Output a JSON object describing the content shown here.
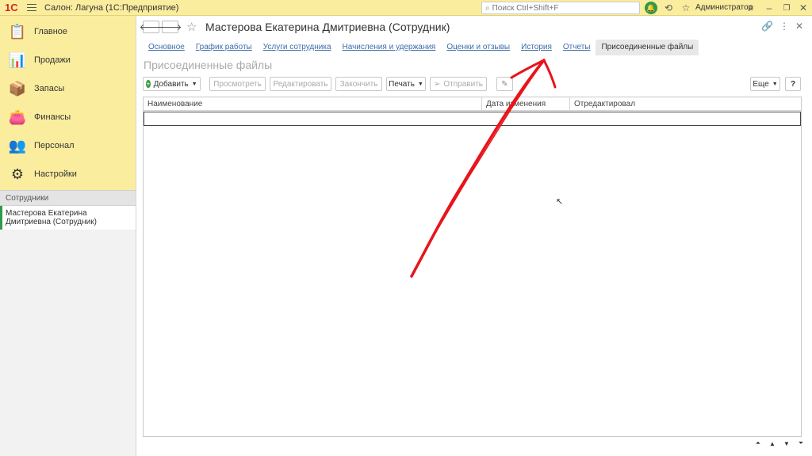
{
  "titlebar": {
    "logo": "1С",
    "app_title": "Салон: Лагуна  (1С:Предприятие)",
    "search_placeholder": "Поиск Ctrl+Shift+F",
    "user": "Администратор"
  },
  "sidebar": {
    "sections": [
      {
        "label": "Главное",
        "icon": "clipboard-icon"
      },
      {
        "label": "Продажи",
        "icon": "chart-bars-icon"
      },
      {
        "label": "Запасы",
        "icon": "boxes-icon"
      },
      {
        "label": "Финансы",
        "icon": "wallet-icon"
      },
      {
        "label": "Персонал",
        "icon": "people-icon"
      },
      {
        "label": "Настройки",
        "icon": "gear-icon"
      }
    ],
    "open_header": "Сотрудники",
    "open_item": "Мастерова Екатерина Дмитриевна (Сотрудник)"
  },
  "form": {
    "title": "Мастерова Екатерина Дмитриевна (Сотрудник)",
    "tabs": [
      "Основное",
      "График работы",
      "Услуги сотрудника",
      "Начисления и удержания",
      "Оценки и отзывы",
      "История",
      "Отчеты",
      "Присоединенные файлы"
    ],
    "active_tab": "Присоединенные файлы",
    "page_title": "Присоединенные файлы"
  },
  "toolbar": {
    "add": "Добавить",
    "view": "Просмотреть",
    "edit": "Редактировать",
    "finish": "Закончить",
    "print": "Печать",
    "send": "Отправить",
    "more": "Еще",
    "help": "?"
  },
  "grid": {
    "columns": [
      "Наименование",
      "Дата изменения",
      "Отредактировал"
    ]
  },
  "colors": {
    "section_bg": "#fbed9e",
    "accent_green": "#2e9a4a",
    "link_blue": "#3c6ea8",
    "annotation_red": "#e8141a"
  }
}
